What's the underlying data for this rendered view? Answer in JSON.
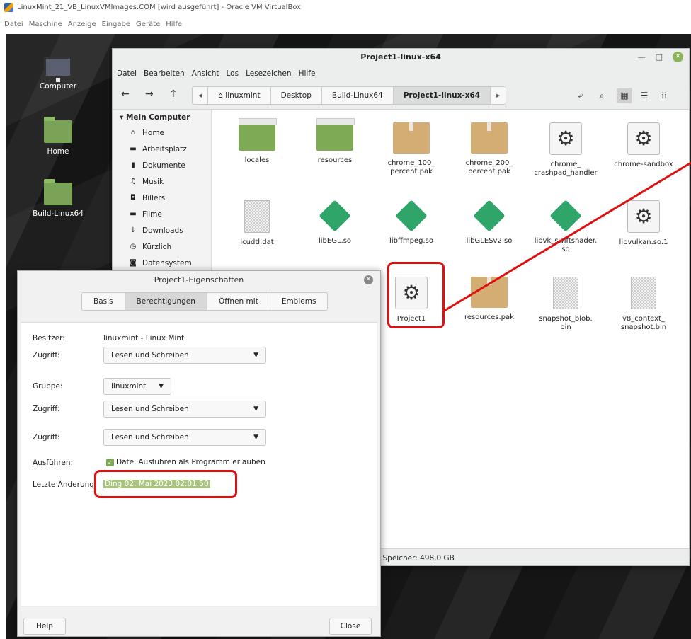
{
  "host": {
    "title": "LinuxMint_21_VB_LinuxVMImages.COM [wird ausgeführt] - Oracle VM VirtualBox",
    "menu": [
      "Datei",
      "Maschine",
      "Anzeige",
      "Eingabe",
      "Geräte",
      "Hilfe"
    ]
  },
  "desktop": {
    "icons": [
      {
        "label": "Computer",
        "icon": "monitor-icon"
      },
      {
        "label": "Home",
        "icon": "home-folder-icon"
      },
      {
        "label": "Build-Linux64",
        "icon": "folder-icon"
      }
    ]
  },
  "file_manager": {
    "title": "Project1-linux-x64",
    "menu": [
      "Datei",
      "Bearbeiten",
      "Ansicht",
      "Los",
      "Lesezeichen",
      "Hilfe"
    ],
    "breadcrumbs": [
      "linuxmint",
      "Desktop",
      "Build-Linux64",
      "Project1-linux-x64"
    ],
    "sidebar": {
      "header": "Mein Computer",
      "items": [
        "Home",
        "Arbeitsplatz",
        "Dokumente",
        "Musik",
        "Billers",
        "Filme",
        "Downloads",
        "Kürzlich",
        "Datensystem"
      ]
    },
    "files": [
      {
        "name": "locales",
        "type": "folder"
      },
      {
        "name": "resources",
        "type": "folder"
      },
      {
        "name": "chrome_100_\npercent.pak",
        "type": "package"
      },
      {
        "name": "chrome_200_\npercent.pak",
        "type": "package"
      },
      {
        "name": "chrome_\ncrashpad_handler",
        "type": "executable"
      },
      {
        "name": "chrome-sandbox",
        "type": "executable"
      },
      {
        "name": "icudtl.dat",
        "type": "text"
      },
      {
        "name": "libEGL.so",
        "type": "library"
      },
      {
        "name": "libffmpeg.so",
        "type": "library"
      },
      {
        "name": "libGLESv2.so",
        "type": "library"
      },
      {
        "name": "libvk_swiftshader.\nso",
        "type": "library"
      },
      {
        "name": "libvulkan.so.1",
        "type": "executable"
      },
      {
        "name": "Project1",
        "type": "executable"
      },
      {
        "name": "resources.pak",
        "type": "package"
      },
      {
        "name": "snapshot_blob.\nbin",
        "type": "text"
      },
      {
        "name": "v8_context_\nsnapshot.bin",
        "type": "text"
      }
    ],
    "status": "eier Speicher: 498,0 GB",
    "zoom_fraction": 0.6
  },
  "dialog": {
    "title": "Project1-Eigenschaften",
    "tabs": [
      "Basis",
      "Berechtigungen",
      "Öffnen mit",
      "Emblems"
    ],
    "active_tab": "Berechtigungen",
    "owner_label": "Besitzer:",
    "owner_value": "linuxmint - Linux Mint",
    "access_label": "Zugriff:",
    "owner_access": "Lesen und Schreiben",
    "group_label": "Gruppe:",
    "group_value": "linuxmint",
    "group_access": "Lesen und Schreiben",
    "other_access": "Lesen und Schreiben",
    "execute_label": "Ausführen:",
    "execute_check": "Datei Ausführen als Programm erlauben",
    "modified_label": "Letzte Änderung",
    "modified_value": "Ding 02. Mai 2023 02:01:50",
    "help_label": "Help",
    "close_label": "Close"
  },
  "colors": {
    "annotation": "#e01010",
    "mint_green": "#7ea955"
  }
}
